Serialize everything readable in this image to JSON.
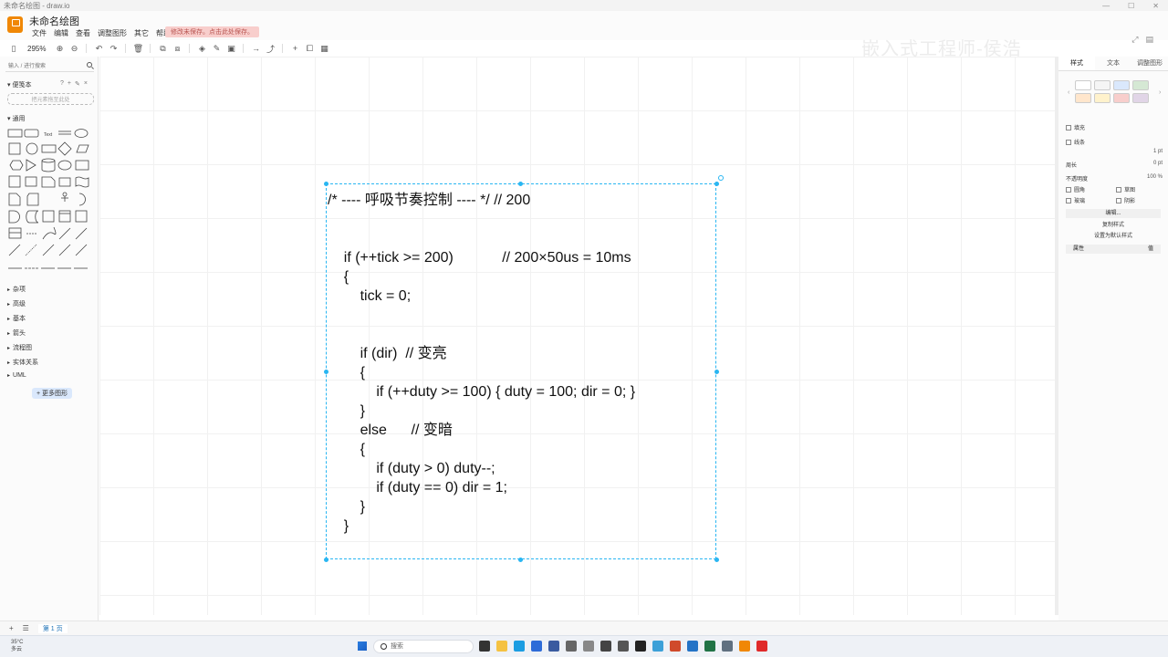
{
  "window": {
    "title": "未命名绘图 - draw.io"
  },
  "app": {
    "doc_title": "未命名绘图",
    "unsaved_notice": "修改未保存。点击此处保存。",
    "watermark": "嵌入式工程师-侯浩"
  },
  "menu": [
    "文件",
    "编辑",
    "查看",
    "调整图形",
    "其它",
    "帮助"
  ],
  "toolbar": {
    "zoom": "295%"
  },
  "sidebar": {
    "search_placeholder": "输入 / 进行搜索",
    "scratchpad_label": "便笺本",
    "dropzone_text": "把元素拖至此处",
    "general_label": "通用",
    "categories": [
      "杂项",
      "高级",
      "基本",
      "箭头",
      "流程图",
      "实体关系",
      "UML"
    ],
    "more_shapes": "+ 更多图形"
  },
  "code_lines": [
    "/* ---- 呼吸节奏控制 ---- */ // 200",
    "",
    "",
    "    if (++tick >= 200)            // 200×50us = 10ms",
    "    {",
    "        tick = 0;",
    "",
    "",
    "        if (dir)  // 变亮",
    "        {",
    "            if (++duty >= 100) { duty = 100; dir = 0; }",
    "        }",
    "        else      // 变暗",
    "        {",
    "            if (duty > 0) duty--;",
    "            if (duty == 0) dir = 1;",
    "        }",
    "    }"
  ],
  "right_panel": {
    "tabs": [
      "样式",
      "文本",
      "调整图形"
    ],
    "fill": "填充",
    "line": "线条",
    "line_width": "1 pt",
    "perimeter": "周长",
    "perimeter_value": "0 pt",
    "opacity": "不透明度",
    "opacity_value": "100 %",
    "rounded": "圆角",
    "sketch": "草图",
    "glass": "玻璃",
    "shadow": "阴影",
    "edit": "编辑...",
    "copy_style": "复制样式",
    "set_default": "设置为默认样式",
    "property": "属性",
    "value": "值"
  },
  "pagebar": {
    "page_tab": "第 1 页"
  },
  "taskbar": {
    "temperature": "35°C",
    "weather": "多云",
    "search": "搜索"
  },
  "colors": {
    "selection": "#29b6f2",
    "logo": "#f08705",
    "unsaved_bg": "#f8cecc"
  }
}
